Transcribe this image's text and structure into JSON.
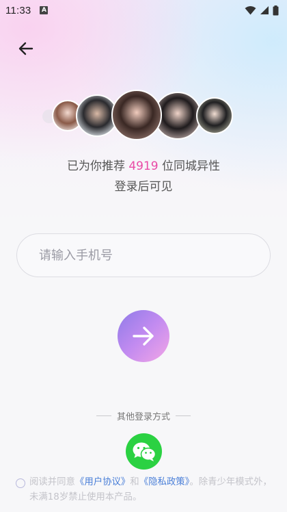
{
  "status_bar": {
    "time": "11:33",
    "notification_icon": "a-icon",
    "icons": [
      "wifi-icon",
      "signal-icon",
      "battery-icon"
    ]
  },
  "header": {
    "back_icon": "arrow-left-icon"
  },
  "recommend": {
    "prefix": "已为你推荐 ",
    "count": "4919",
    "suffix": " 位同城异性",
    "subline": "登录后可见",
    "count_color": "#e94aa6"
  },
  "phone_input": {
    "placeholder": "请输入手机号",
    "value": ""
  },
  "submit": {
    "icon": "arrow-right-icon"
  },
  "other_login": {
    "label": "其他登录方式",
    "wechat_icon": "wechat-icon",
    "wechat_color": "#2bd142"
  },
  "agreement": {
    "prefix": "阅读并同意",
    "user_agreement": "《用户协议》",
    "and": "和",
    "privacy_policy": "《隐私政策》",
    "suffix": "。除青少年模式外，未满18岁禁止使用本产品。",
    "link_color": "#4a7fd8"
  }
}
